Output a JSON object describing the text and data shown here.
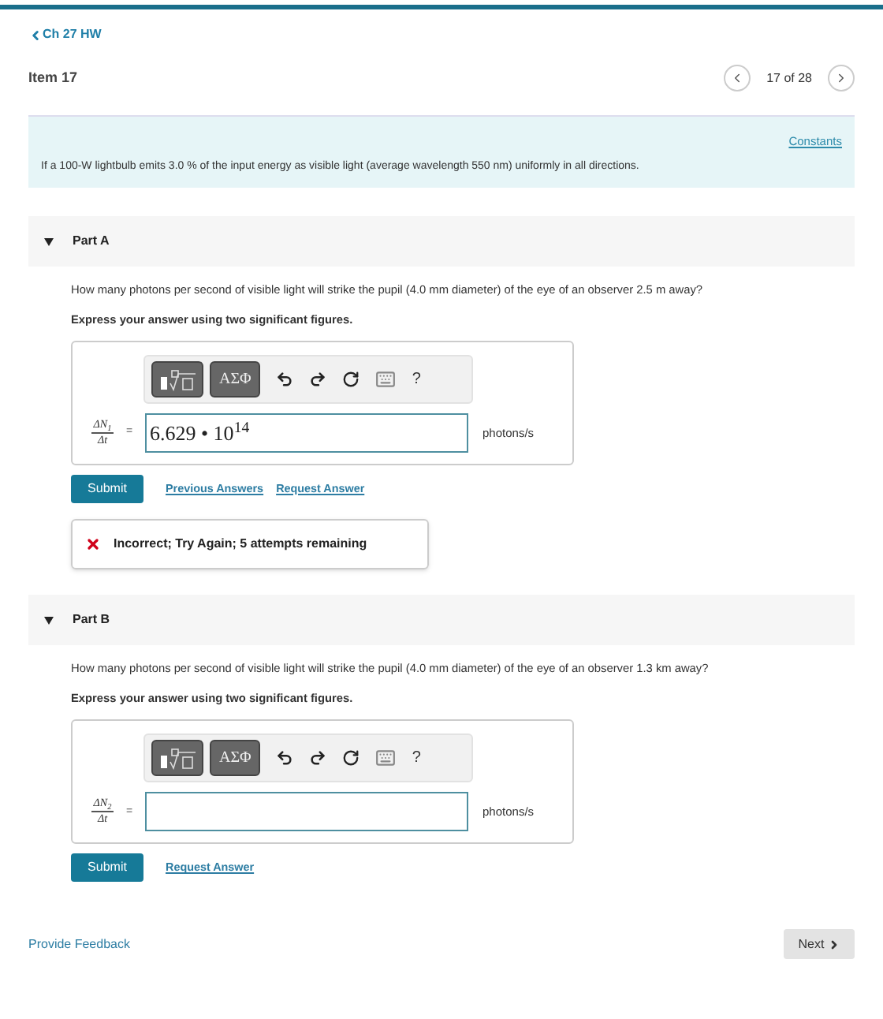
{
  "breadcrumb": {
    "label": "Ch 27 HW"
  },
  "item": {
    "title": "Item 17",
    "position": "17 of 28"
  },
  "intro": {
    "link": "Constants",
    "text": "If a 100-W lightbulb emits 3.0 % of the input energy as visible light (average wavelength 550 nm) uniformly in all directions."
  },
  "parts": [
    {
      "title": "Part A",
      "expanded": true,
      "question": "How many photons per second of visible light will strike the pupil (4.0 mm diameter) of the eye of an observer 2.5  m away?",
      "instruction": "Express your answer using two significant figures.",
      "toolbar": {
        "symbols": "ΑΣΦ",
        "help": "?"
      },
      "numerator": "ΔN$_{1}$",
      "denominator": "Δt",
      "equals": "=",
      "value": "6.629 • 10$^{14}$",
      "unit": "photons/s",
      "submit": "Submit",
      "links": [
        "Previous Answers",
        "Request Answer"
      ],
      "feedback": {
        "kind": "incorrect",
        "text": "Incorrect; Try Again; 5 attempts remaining"
      }
    },
    {
      "title": "Part B",
      "expanded": true,
      "question": "How many photons per second of visible light will strike the pupil (4.0 mm diameter) of the eye of an observer 1.3  km away?",
      "instruction": "Express your answer using two significant figures.",
      "toolbar": {
        "symbols": "ΑΣΦ",
        "help": "?"
      },
      "numerator": "ΔN$_{2}$",
      "denominator": "Δt",
      "equals": "=",
      "unit": "photons/s",
      "submit": "Submit",
      "links": [
        "Request Answer"
      ]
    }
  ],
  "footer": {
    "feedback_link": "Provide Feedback",
    "next": "Next"
  }
}
